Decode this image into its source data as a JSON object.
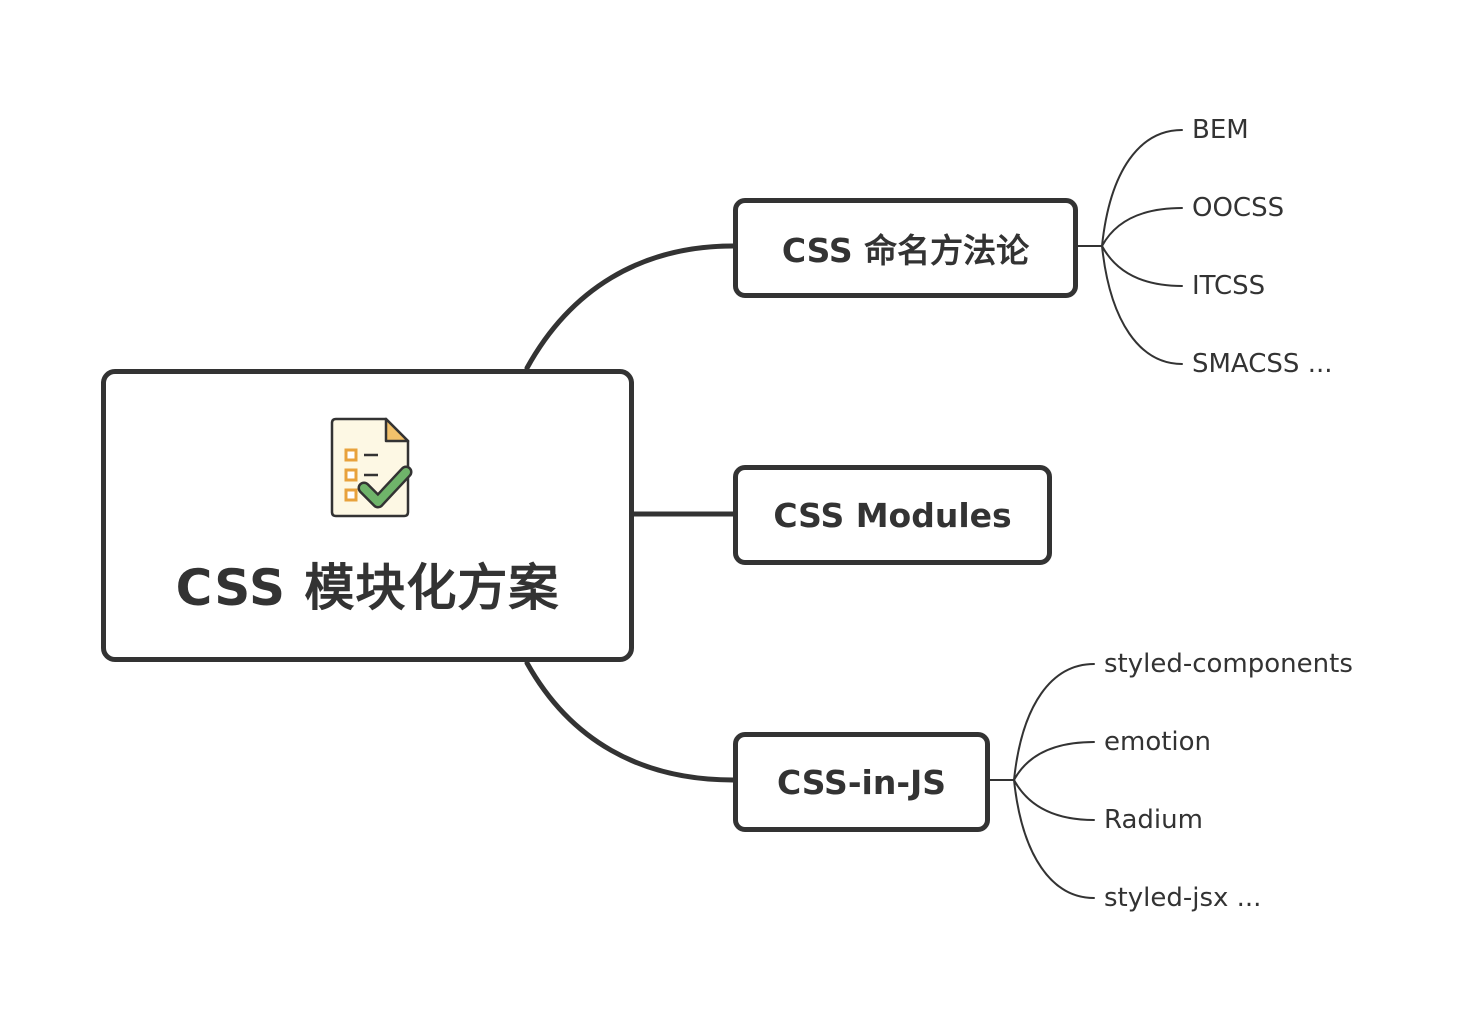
{
  "mindmap": {
    "central": {
      "title": "CSS 模块化方案",
      "icon": "checklist-document-icon"
    },
    "branches": [
      {
        "label": "CSS 命名方法论",
        "leaves": [
          "BEM",
          "OOCSS",
          "ITCSS",
          "SMACSS ..."
        ]
      },
      {
        "label": "CSS Modules",
        "leaves": []
      },
      {
        "label": "CSS-in-JS",
        "leaves": [
          "styled-components",
          "emotion",
          "Radium",
          "styled-jsx ..."
        ]
      }
    ]
  },
  "colors": {
    "line": "#333333",
    "icon_paper": "#fdf8e4",
    "icon_fold": "#f2c16b",
    "icon_box": "#e8a23c",
    "icon_check": "#6fb46a"
  }
}
